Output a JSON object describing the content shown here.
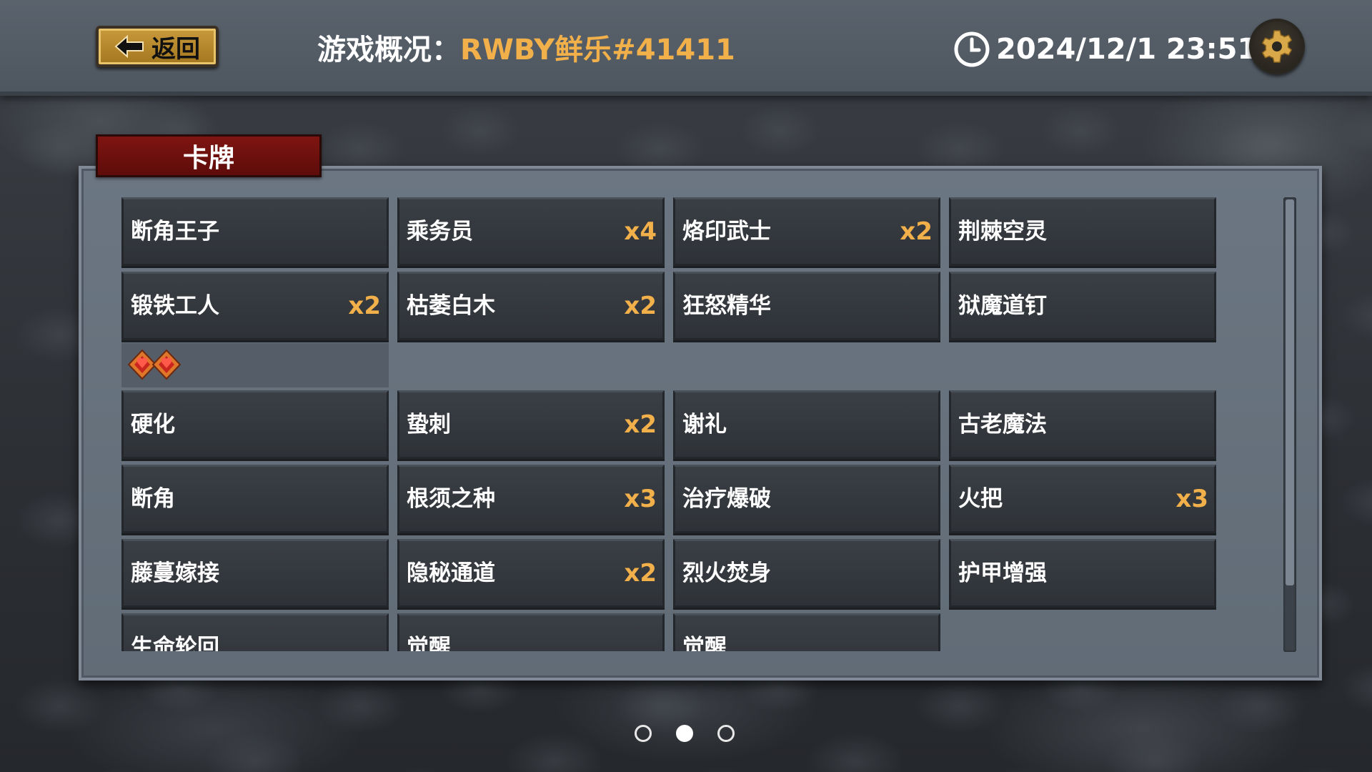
{
  "header": {
    "back_label": "返回",
    "title_label": "游戏概况：",
    "game_name": "RWBY鲜乐#41411",
    "datetime": "2024/12/1 23:51",
    "accent_color": "#f2b04a"
  },
  "tab": {
    "label": "卡牌"
  },
  "cards": [
    {
      "name": "断角王子",
      "count": ""
    },
    {
      "name": "乘务员",
      "count": "x4"
    },
    {
      "name": "烙印武士",
      "count": "x2"
    },
    {
      "name": "荆棘空灵",
      "count": ""
    },
    {
      "name": "锻铁工人",
      "count": "x2"
    },
    {
      "name": "枯萎白木",
      "count": "x2"
    },
    {
      "name": "狂怒精华",
      "count": ""
    },
    {
      "name": "狱魔道钉",
      "count": ""
    },
    {
      "name": "硬化",
      "count": ""
    },
    {
      "name": "蛰刺",
      "count": "x2"
    },
    {
      "name": "谢礼",
      "count": ""
    },
    {
      "name": "古老魔法",
      "count": ""
    },
    {
      "name": "断角",
      "count": ""
    },
    {
      "name": "根须之种",
      "count": "x3"
    },
    {
      "name": "治疗爆破",
      "count": ""
    },
    {
      "name": "火把",
      "count": "x3"
    },
    {
      "name": "藤蔓嫁接",
      "count": ""
    },
    {
      "name": "隐秘通道",
      "count": "x2"
    },
    {
      "name": "烈火焚身",
      "count": ""
    },
    {
      "name": "护甲增强",
      "count": ""
    },
    {
      "name": "生命轮回",
      "count": ""
    },
    {
      "name": "觉醒",
      "count": ""
    },
    {
      "name": "觉醒",
      "count": ""
    }
  ],
  "pagination": {
    "pages": 3,
    "current": 2
  },
  "icons": {
    "back": "back-arrow-icon",
    "clock": "clock-icon",
    "settings": "gear-icon",
    "gem": "red-gem-icon"
  }
}
